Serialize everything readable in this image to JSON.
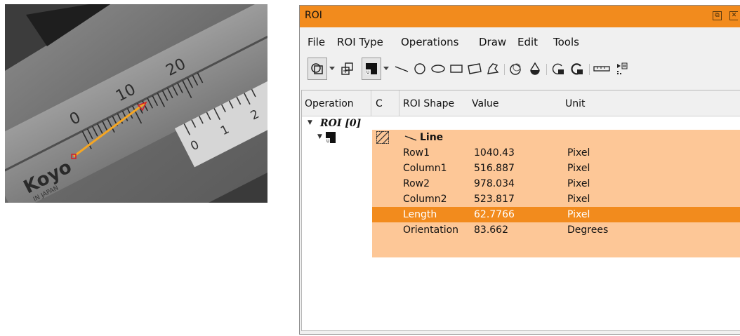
{
  "image_view": {
    "ruler_major_labels": [
      "0",
      "10",
      "20"
    ],
    "vernier_labels": [
      "0",
      "1",
      "2"
    ],
    "brand_text": "Koyo",
    "origin_text": "IN JAPAN",
    "line_color": "#f5a623"
  },
  "window": {
    "title": "ROI",
    "restore_label": "⧉",
    "close_label": "✕",
    "accent_color": "#f28b1d",
    "row_highlight_color": "#fdc797"
  },
  "menu": {
    "items": [
      "File",
      "ROI Type",
      "Operations",
      "Draw",
      "Edit",
      "Tools"
    ]
  },
  "toolbar": {
    "tools": [
      "roi-combine-icon",
      "dropdown-arrow-icon",
      "add-roi-icon",
      "color-swatch-icon",
      "dropdown-arrow-icon",
      "line-icon",
      "circle-icon",
      "ellipse-icon",
      "rectangle-icon",
      "rotated-rectangle-icon",
      "polygon-icon",
      "ring-icon",
      "drop-icon",
      "lock-region-icon",
      "lock-region-filled-icon",
      "ruler-icon",
      "export-icon"
    ]
  },
  "table": {
    "columns": [
      "Operation",
      "C",
      "ROI Shape",
      "Value",
      "Unit"
    ],
    "group_label": "ROI [0]",
    "shape_label": "Line",
    "rows": [
      {
        "name": "Row1",
        "value": "1040.43",
        "unit": "Pixel"
      },
      {
        "name": "Column1",
        "value": "516.887",
        "unit": "Pixel"
      },
      {
        "name": "Row2",
        "value": "978.034",
        "unit": "Pixel"
      },
      {
        "name": "Column2",
        "value": "523.817",
        "unit": "Pixel"
      },
      {
        "name": "Length",
        "value": "62.7766",
        "unit": "Pixel"
      },
      {
        "name": "Orientation",
        "value": "83.662",
        "unit": "Degrees"
      }
    ],
    "selected_row": "Length"
  }
}
